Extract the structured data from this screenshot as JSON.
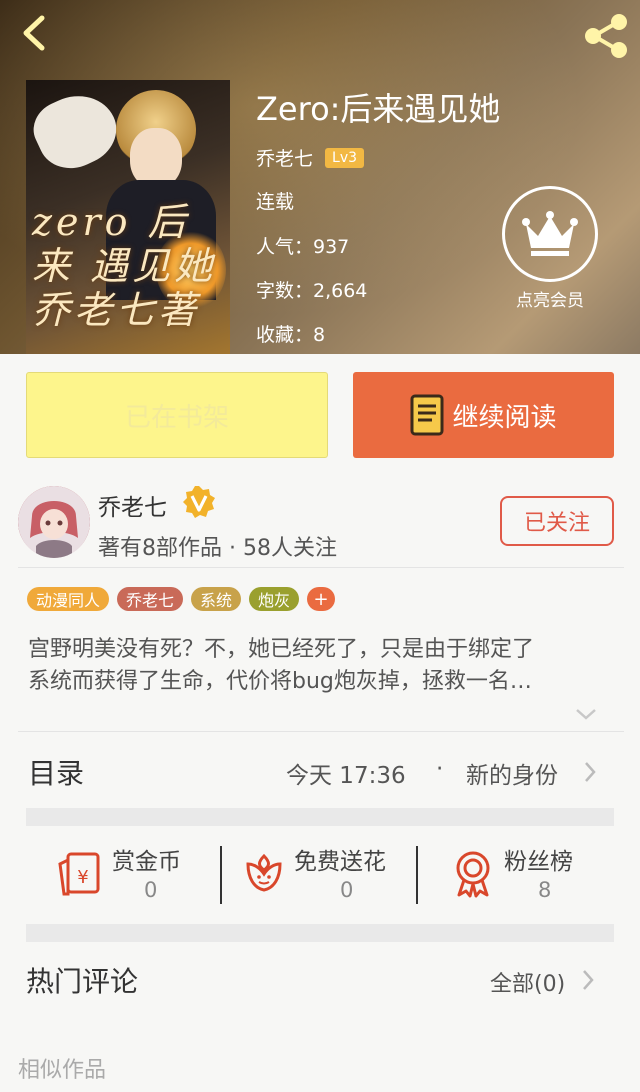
{
  "header": {
    "book_title": "Zero:后来遇见她",
    "author": "乔老七",
    "level": "Lv3",
    "status": "连载",
    "popularity": "人气：937",
    "word_count": "字数：2,664",
    "favorites": "收藏：8",
    "vip_label": "点亮会员",
    "cover_art_text": "zero 后来 遇见她 乔老七著"
  },
  "actions": {
    "on_shelf": "已在书架",
    "continue_reading": "继续阅读"
  },
  "author_card": {
    "name": "乔老七",
    "stats": "著有8部作品 · 58人关注",
    "follow_label": "已关注"
  },
  "tags": [
    {
      "label": "动漫同人",
      "color": "#f0a93a"
    },
    {
      "label": "乔老七",
      "color": "#c96a58"
    },
    {
      "label": "系统",
      "color": "#c8a24a"
    },
    {
      "label": "炮灰",
      "color": "#9aa02e"
    },
    {
      "label": "+",
      "color": "#ea6b40"
    }
  ],
  "synopsis": {
    "line1": "宫野明美没有死？不，她已经死了，只是由于绑定了",
    "line2": "系统而获得了生命，代价将bug炮灰掉，拯救一名…"
  },
  "catalog": {
    "label": "目录",
    "time": "今天  17:36",
    "dot": "·",
    "latest_chapter": "新的身份"
  },
  "stats": [
    {
      "label": "赏金币",
      "value": "0",
      "icon": "red-envelope-icon"
    },
    {
      "label": "免费送花",
      "value": "0",
      "icon": "flower-icon"
    },
    {
      "label": "粉丝榜",
      "value": "8",
      "icon": "medal-icon"
    }
  ],
  "comments": {
    "label": "热门评论",
    "all": "全部(0)"
  },
  "similar": {
    "label": "相似作品"
  },
  "colors": {
    "accent": "#ea6b40",
    "shelf_button": "#fdf58c",
    "follow_border": "#e05a48",
    "level_badge": "#f2b843",
    "stat_icon": "#d9472b"
  }
}
